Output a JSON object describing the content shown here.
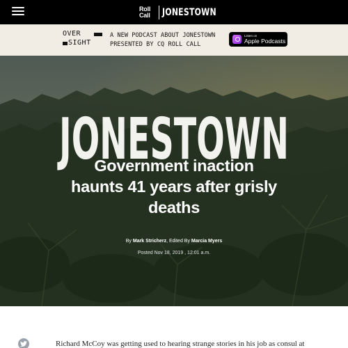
{
  "header": {
    "brand_logo": "Roll Call",
    "brand_title": "JONESTOWN",
    "menu_icon": "hamburger-menu-icon"
  },
  "promo": {
    "logo_line1": "OVER",
    "logo_line2": "SIGHT",
    "text_line1": "A NEW PODCAST ABOUT JONESTOWN",
    "text_line2": "PRESENTED BY CQ ROLL CALL",
    "apple_small": "Listen on",
    "apple_big": "Apple Podcasts"
  },
  "hero": {
    "wordmark": "JONESTOWN",
    "headline_line1": "Government inaction",
    "headline_line2": "haunts 41 years after grisly",
    "headline_line3": "deaths",
    "byline_prefix": "By ",
    "author": "Mark Stricherz",
    "edited_prefix": ", Edited By ",
    "editor": "Marcia Myers",
    "posted": "Posted Nov 18, 2019 , 12:01 a.m."
  },
  "article": {
    "first_line": "Richard McCoy was getting used to hearing strange stories in his job as consul at",
    "share_icon": "twitter-icon"
  },
  "colors": {
    "topbar": "#000000",
    "promo_bg": "#f2ede4",
    "hero_dark": "#263322",
    "text_white": "#ffffff"
  }
}
